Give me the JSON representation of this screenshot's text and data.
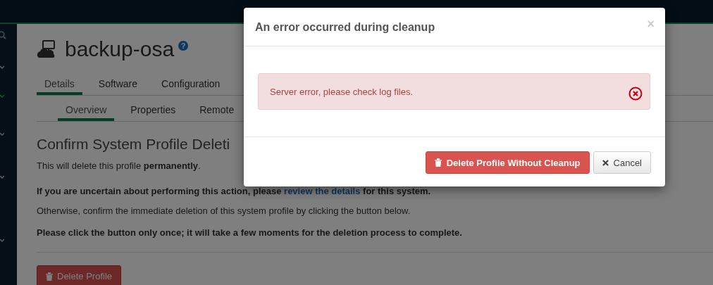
{
  "system": {
    "name": "backup-osa",
    "help": "?"
  },
  "tabs": [
    {
      "label": "Details",
      "selected": true
    },
    {
      "label": "Software",
      "selected": false
    },
    {
      "label": "Configuration",
      "selected": false
    }
  ],
  "subtabs": [
    {
      "label": "Overview",
      "selected": true
    },
    {
      "label": "Properties",
      "selected": false
    },
    {
      "label": "Remote",
      "selected": false
    }
  ],
  "sidebar": {
    "items": [
      {
        "active": false
      },
      {
        "active": true
      },
      {
        "active": false
      },
      {
        "active": false
      },
      {
        "active": false
      }
    ]
  },
  "heading": "Confirm System Profile Deleti",
  "paragraphs": [
    {
      "kind": "plain",
      "text": "This will delete this profile **permanently**."
    },
    {
      "kind": "link",
      "before": "If you are uncertain about performing this action, please ",
      "link": "review the details",
      "after": " for this system."
    },
    {
      "kind": "plain",
      "text": "Otherwise, confirm the immediate deletion of this system profile by clicking the button below."
    },
    {
      "kind": "bold",
      "text": "Please click the button only once; it will take a few moments for the deletion process to complete."
    }
  ],
  "delete_button": "Delete Profile",
  "modal": {
    "title": "An error occurred during cleanup",
    "close": "×",
    "alert": "Server error, please check log files.",
    "confirm_button": "Delete Profile Without Cleanup",
    "cancel_button": "Cancel"
  }
}
